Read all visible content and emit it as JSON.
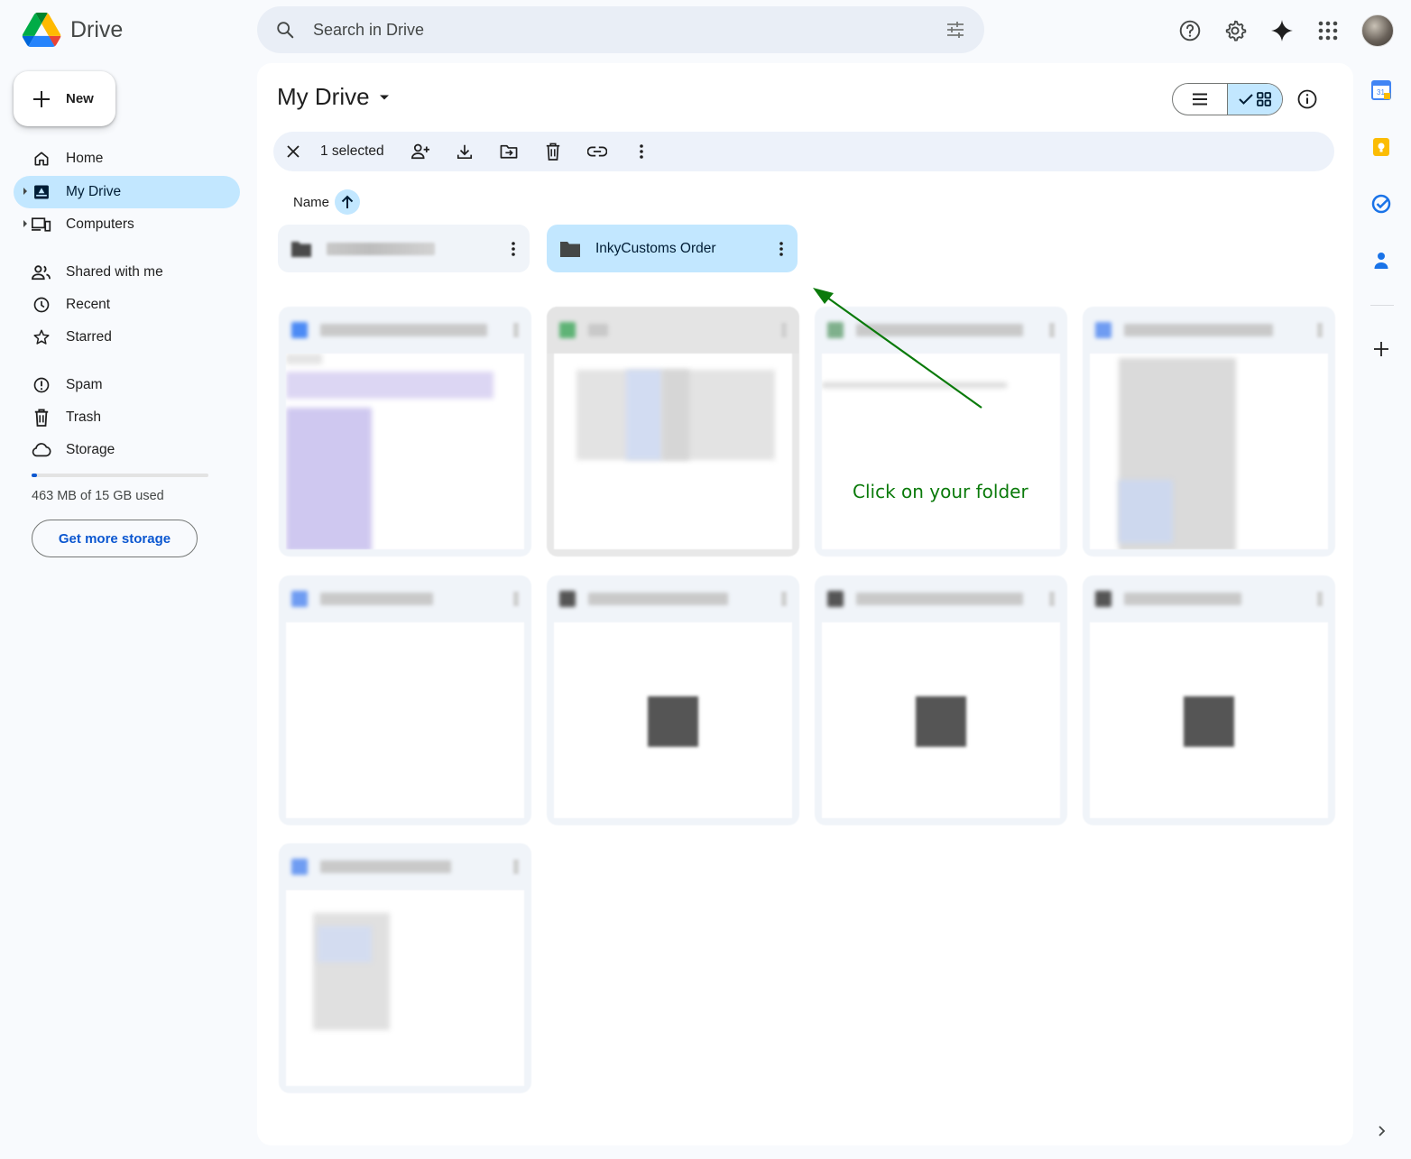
{
  "app": {
    "name": "Drive"
  },
  "search": {
    "placeholder": "Search in Drive"
  },
  "nav": {
    "new_label": "New",
    "items": [
      {
        "label": "Home",
        "icon": "home-icon"
      },
      {
        "label": "My Drive",
        "icon": "my-drive-icon",
        "active": true
      },
      {
        "label": "Computers",
        "icon": "computer-icon"
      },
      {
        "label": "Shared with me",
        "icon": "people-icon"
      },
      {
        "label": "Recent",
        "icon": "clock-icon"
      },
      {
        "label": "Starred",
        "icon": "star-icon"
      },
      {
        "label": "Spam",
        "icon": "spam-icon"
      },
      {
        "label": "Trash",
        "icon": "trash-icon"
      },
      {
        "label": "Storage",
        "icon": "cloud-icon"
      }
    ],
    "storage_text": "463 MB of 15 GB used",
    "storage_fraction": 0.03,
    "get_more_storage": "Get more storage"
  },
  "main": {
    "title": "My Drive",
    "selection": {
      "count_label": "1 selected"
    },
    "sort": {
      "label": "Name",
      "direction": "ascending"
    },
    "folders": [
      {
        "name": "",
        "selected": false
      },
      {
        "name": "InkyCustoms Order",
        "selected": true
      }
    ]
  },
  "annotation": {
    "text": "Click on your folder",
    "color": "#0a7a0a"
  },
  "colors": {
    "accent": "#0b57d0",
    "selected": "#c2e7ff",
    "surface": "#f8fafd"
  }
}
